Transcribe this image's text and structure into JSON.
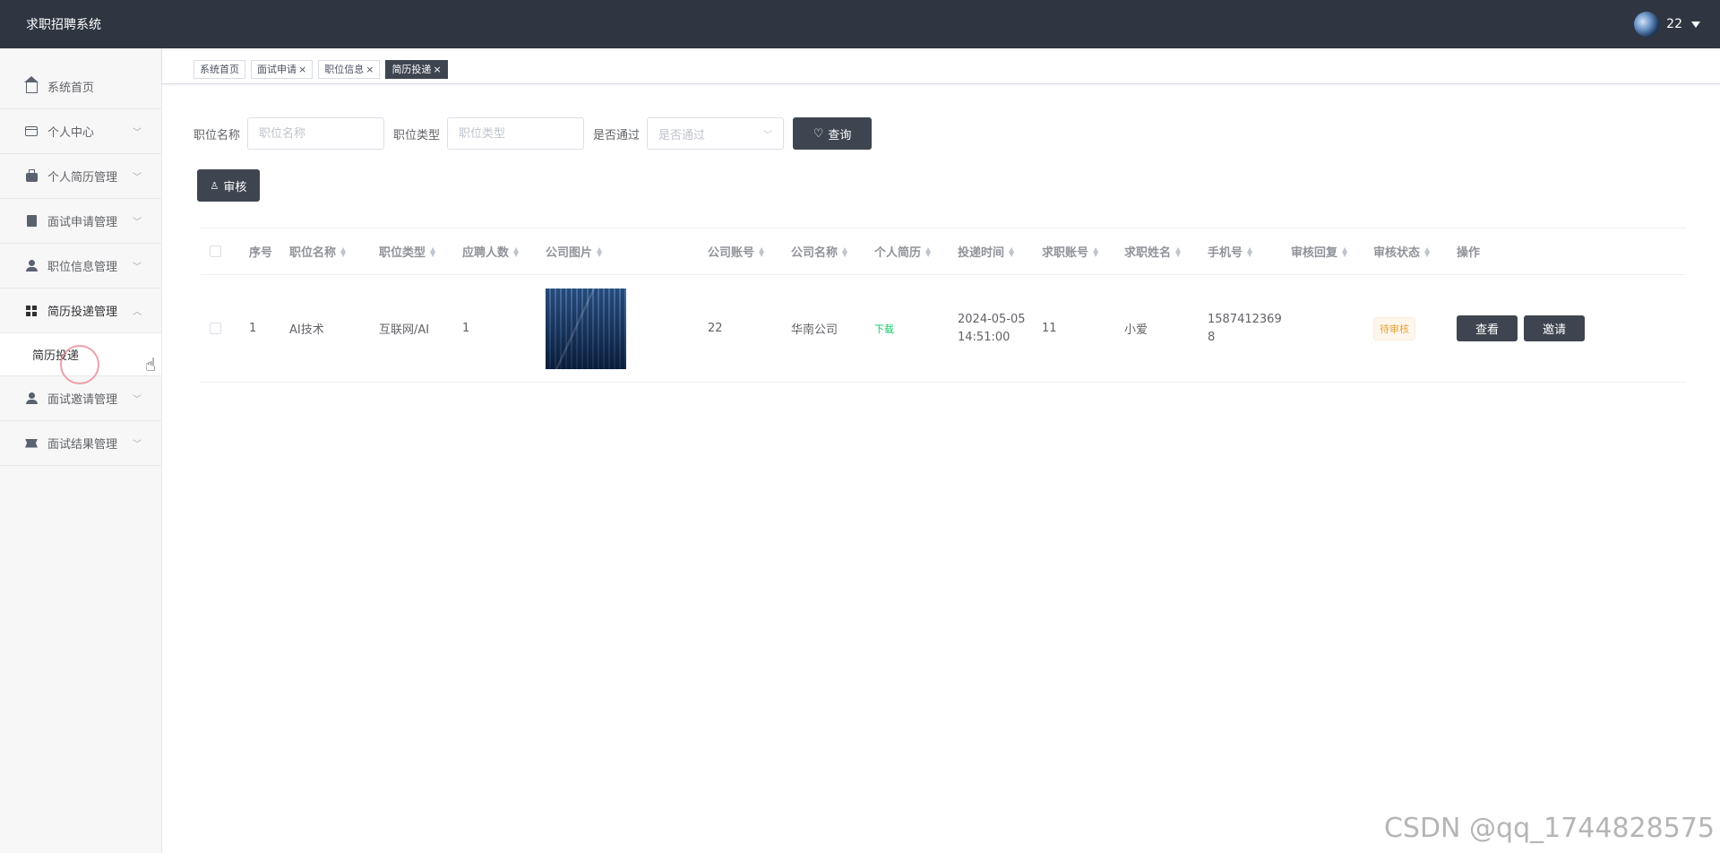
{
  "header": {
    "title": "求职招聘系统",
    "username": "22"
  },
  "sidebar": {
    "items": [
      {
        "label": "系统首页",
        "icon": "home-icon"
      },
      {
        "label": "个人中心",
        "icon": "card-icon"
      },
      {
        "label": "个人简历管理",
        "icon": "briefcase-icon"
      },
      {
        "label": "面试申请管理",
        "icon": "clipboard-icon"
      },
      {
        "label": "职位信息管理",
        "icon": "user-icon"
      },
      {
        "label": "简历投递管理",
        "icon": "grid-icon"
      },
      {
        "label": "面试邀请管理",
        "icon": "user-tie-icon"
      },
      {
        "label": "面试结果管理",
        "icon": "ticket-icon"
      }
    ],
    "submenu_label": "简历投递"
  },
  "tabs": [
    {
      "label": "系统首页",
      "closable": false
    },
    {
      "label": "面试申请",
      "closable": true
    },
    {
      "label": "职位信息",
      "closable": true
    },
    {
      "label": "简历投递",
      "closable": true
    }
  ],
  "search": {
    "job_name_label": "职位名称",
    "job_name_placeholder": "职位名称",
    "job_type_label": "职位类型",
    "job_type_placeholder": "职位类型",
    "passed_label": "是否通过",
    "passed_placeholder": "是否通过",
    "query_label": "查询"
  },
  "audit_label": "审核",
  "table": {
    "headers": [
      "序号",
      "职位名称",
      "职位类型",
      "应聘人数",
      "公司图片",
      "公司账号",
      "公司名称",
      "个人简历",
      "投递时间",
      "求职账号",
      "求职姓名",
      "手机号",
      "审核回复",
      "审核状态",
      "操作"
    ],
    "rows": [
      {
        "index": "1",
        "job_name": "AI技术",
        "job_type": "互联网/AI",
        "applicants": "1",
        "company_account": "22",
        "company_name": "华南公司",
        "resume": "下载",
        "submit_date": "2024-05-05",
        "submit_time": "14:51:00",
        "seeker_account": "11",
        "seeker_name": "小爱",
        "phone_line1": "1587412369",
        "phone_line2": "8",
        "reply": "",
        "status": "待审核",
        "view_label": "查看",
        "invite_label": "邀请"
      }
    ]
  },
  "watermark": "CSDN @qq_1744828575",
  "colors": {
    "header_bg": "#2f3541",
    "button_dark": "#3f4550",
    "status_pending": "#e6a23c",
    "download": "#13ce66"
  }
}
